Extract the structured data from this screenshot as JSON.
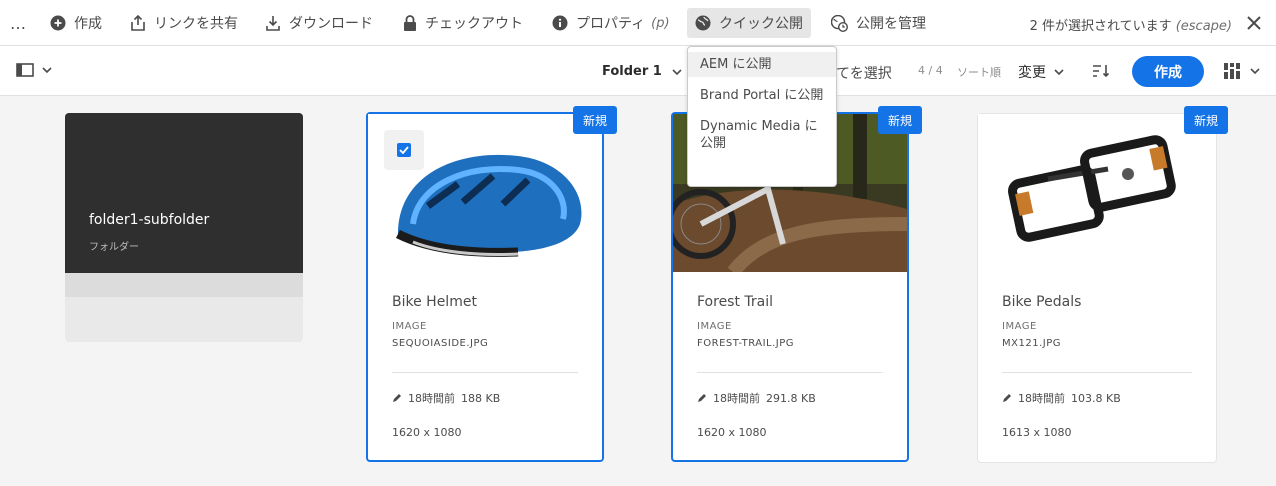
{
  "actionbar": {
    "more_label": "…",
    "create_label": "作成",
    "share_link_label": "リンクを共有",
    "download_label": "ダウンロード",
    "checkout_label": "チェックアウト",
    "properties_label": "プロパティ",
    "properties_shortcut": "(p)",
    "quick_publish_label": "クイック公開",
    "manage_publication_label": "公開を管理",
    "selection_count": "2 件が選択されています",
    "selection_escape": "(escape)"
  },
  "toolbar": {
    "folder_title": "Folder 1",
    "select_all_partial": "てを選択",
    "count": "4 / 4",
    "sort_label": "ソート順",
    "sort_value": "変更",
    "create_button": "作成"
  },
  "quick_publish_menu": {
    "items": [
      "AEM に公開",
      "Brand Portal に公開",
      "Dynamic Media に公開"
    ]
  },
  "cards": [
    {
      "kind": "folder",
      "title": "folder1-subfolder",
      "type": "フォルダー"
    },
    {
      "kind": "asset",
      "title": "Bike Helmet",
      "type": "IMAGE",
      "file": "SEQUOIASIDE.JPG",
      "modified": "18時間前",
      "size": "188 KB",
      "dims": "1620 x 1080",
      "badge": "新規",
      "selected": true,
      "checked": true
    },
    {
      "kind": "asset",
      "title": "Forest Trail",
      "type": "IMAGE",
      "file": "FOREST-TRAIL.JPG",
      "modified": "18時間前",
      "size": "291.8 KB",
      "dims": "1620 x 1080",
      "badge": "新規",
      "selected": true,
      "checked": false
    },
    {
      "kind": "asset",
      "title": "Bike Pedals",
      "type": "IMAGE",
      "file": "MX121.JPG",
      "modified": "18時間前",
      "size": "103.8 KB",
      "dims": "1613 x 1080",
      "badge": "新規",
      "selected": false,
      "checked": false
    }
  ],
  "colors": {
    "accent": "#1473e6",
    "folder_bg": "#2f2f2f",
    "page_bg": "#f4f4f4"
  }
}
